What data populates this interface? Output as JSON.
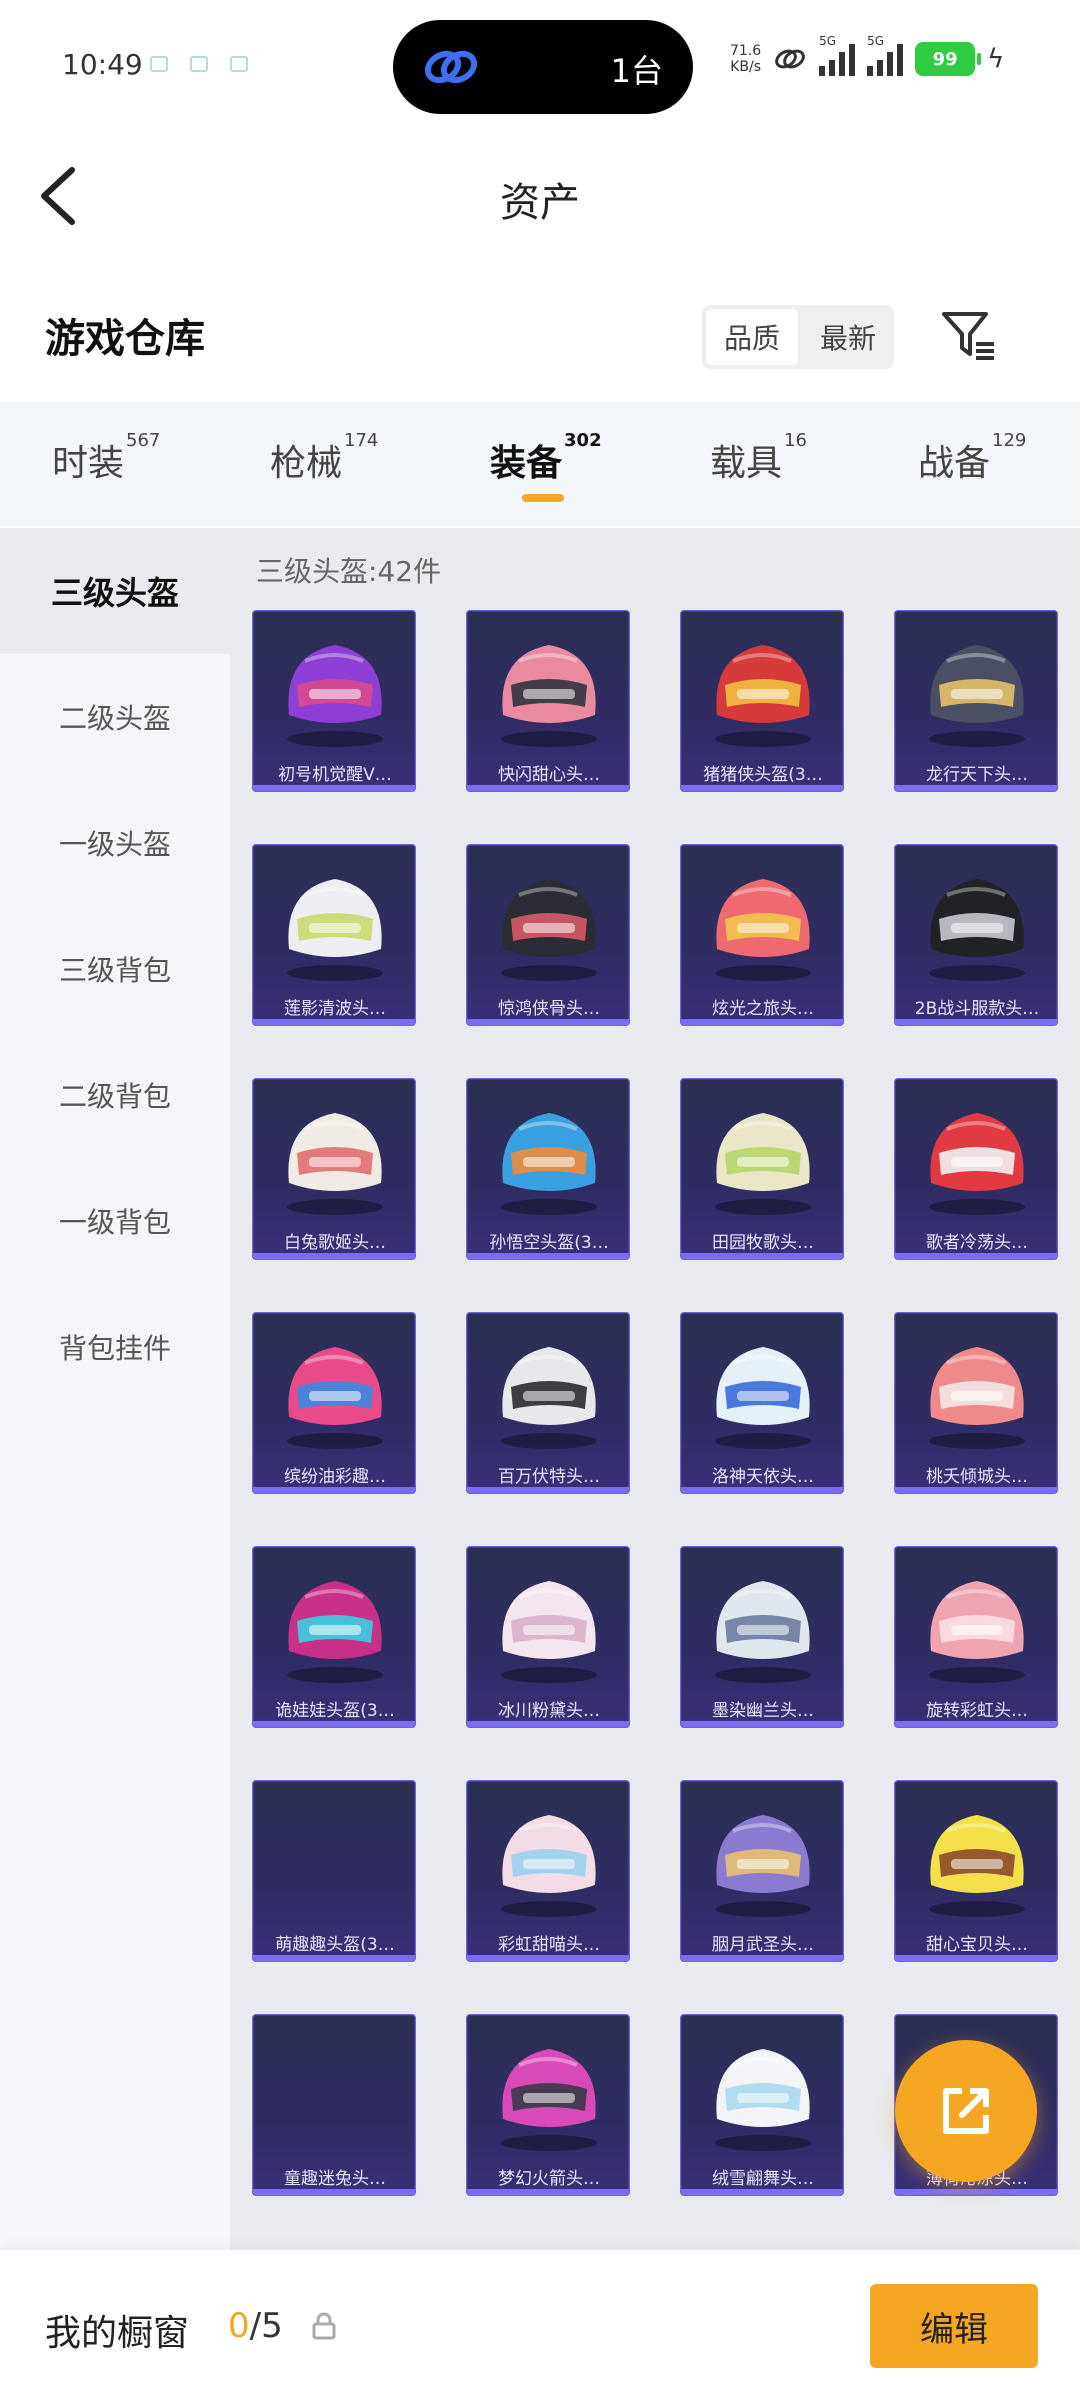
{
  "status_bar": {
    "time": "10:49",
    "island_text": "1台",
    "net_speed": "71.6",
    "net_unit": "KB/s",
    "sim1": "5G",
    "sim2": "5G",
    "battery": "99"
  },
  "header": {
    "title": "资产",
    "back_icon": "chevron-left-icon"
  },
  "warehouse": {
    "title": "游戏仓库",
    "sort_options": [
      "品质",
      "最新"
    ],
    "active_sort": "品质",
    "filter_icon": "filter-icon"
  },
  "category_tabs": [
    {
      "label": "时装",
      "count": "567"
    },
    {
      "label": "枪械",
      "count": "174"
    },
    {
      "label": "装备",
      "count": "302",
      "active": true
    },
    {
      "label": "载具",
      "count": "16"
    },
    {
      "label": "战备",
      "count": "129"
    }
  ],
  "side_nav": [
    {
      "label": "三级头盔",
      "active": true
    },
    {
      "label": "二级头盔"
    },
    {
      "label": "一级头盔"
    },
    {
      "label": "三级背包"
    },
    {
      "label": "二级背包"
    },
    {
      "label": "一级背包"
    },
    {
      "label": "背包挂件"
    }
  ],
  "section_label": "三级头盔:42件",
  "items": [
    {
      "name": "初号机觉醒V…",
      "color": "#8e3fd6",
      "accent": "#d84a8c"
    },
    {
      "name": "快闪甜心头…",
      "color": "#e98aa0",
      "accent": "#333340"
    },
    {
      "name": "猪猪侠头盔(3…",
      "color": "#d63a3a",
      "accent": "#f0c040"
    },
    {
      "name": "龙行天下头…",
      "color": "#4a4f63",
      "accent": "#e3c06a"
    },
    {
      "name": "莲影清波头…",
      "color": "#eeeef2",
      "accent": "#c9d86a"
    },
    {
      "name": "惊鸿侠骨头…",
      "color": "#2c2c34",
      "accent": "#d85a6a"
    },
    {
      "name": "炫光之旅头…",
      "color": "#ee6a70",
      "accent": "#f2c64a"
    },
    {
      "name": "2B战斗服款头…",
      "color": "#202226",
      "accent": "#c8c8d0"
    },
    {
      "name": "白兔歌姬头…",
      "color": "#f0ebe4",
      "accent": "#e07070"
    },
    {
      "name": "孙悟空头盔(3…",
      "color": "#3aa0e0",
      "accent": "#f08a3a"
    },
    {
      "name": "田园牧歌头…",
      "color": "#eae6c8",
      "accent": "#b7d46a"
    },
    {
      "name": "歌者冷荡头…",
      "color": "#e13a42",
      "accent": "#f2f2f2"
    },
    {
      "name": "缤纷油彩趣…",
      "color": "#e84a8a",
      "accent": "#3a8ae0"
    },
    {
      "name": "百万伏特头…",
      "color": "#e8e8ec",
      "accent": "#2a2a30"
    },
    {
      "name": "洛神天依头…",
      "color": "#e6f0fb",
      "accent": "#3a6ad8"
    },
    {
      "name": "桃夭倾城头…",
      "color": "#f08a8a",
      "accent": "#f6e6e6"
    },
    {
      "name": "诡娃娃头盔(3…",
      "color": "#c8308a",
      "accent": "#3ad0e0"
    },
    {
      "name": "冰川粉黛头…",
      "color": "#f4e6ee",
      "accent": "#d8b0c8"
    },
    {
      "name": "墨染幽兰头…",
      "color": "#dfe6ee",
      "accent": "#6a7aa0"
    },
    {
      "name": "旋转彩虹头…",
      "color": "#f0a4b0",
      "accent": "#fbe0e4"
    },
    {
      "name": "萌趣趣头盔(3…",
      "color": "",
      "accent": ""
    },
    {
      "name": "彩虹甜喵头…",
      "color": "#f2dce6",
      "accent": "#9ad0f0"
    },
    {
      "name": "胭月武圣头…",
      "color": "#8a7ad0",
      "accent": "#e8c070"
    },
    {
      "name": "甜心宝贝头…",
      "color": "#f4e04a",
      "accent": "#8a4a2a"
    },
    {
      "name": "童趣迷兔头…",
      "color": "",
      "accent": ""
    },
    {
      "name": "梦幻火箭头…",
      "color": "#d84ab8",
      "accent": "#3a3a48"
    },
    {
      "name": "绒雪翩舞头…",
      "color": "#f2f4f8",
      "accent": "#a8d8f0"
    },
    {
      "name": "薄荷沁凉头…",
      "color": "",
      "accent": ""
    }
  ],
  "fab_icon": "share-external-icon",
  "bottom_bar": {
    "showcase_label": "我的橱窗",
    "showcase_current": "0",
    "showcase_total": "/5",
    "lock_icon": "lock-icon",
    "edit_label": "编辑"
  },
  "colors": {
    "accent": "#f5a623",
    "card_border": "#6f62d8",
    "card_bg": "#2f2c63"
  }
}
